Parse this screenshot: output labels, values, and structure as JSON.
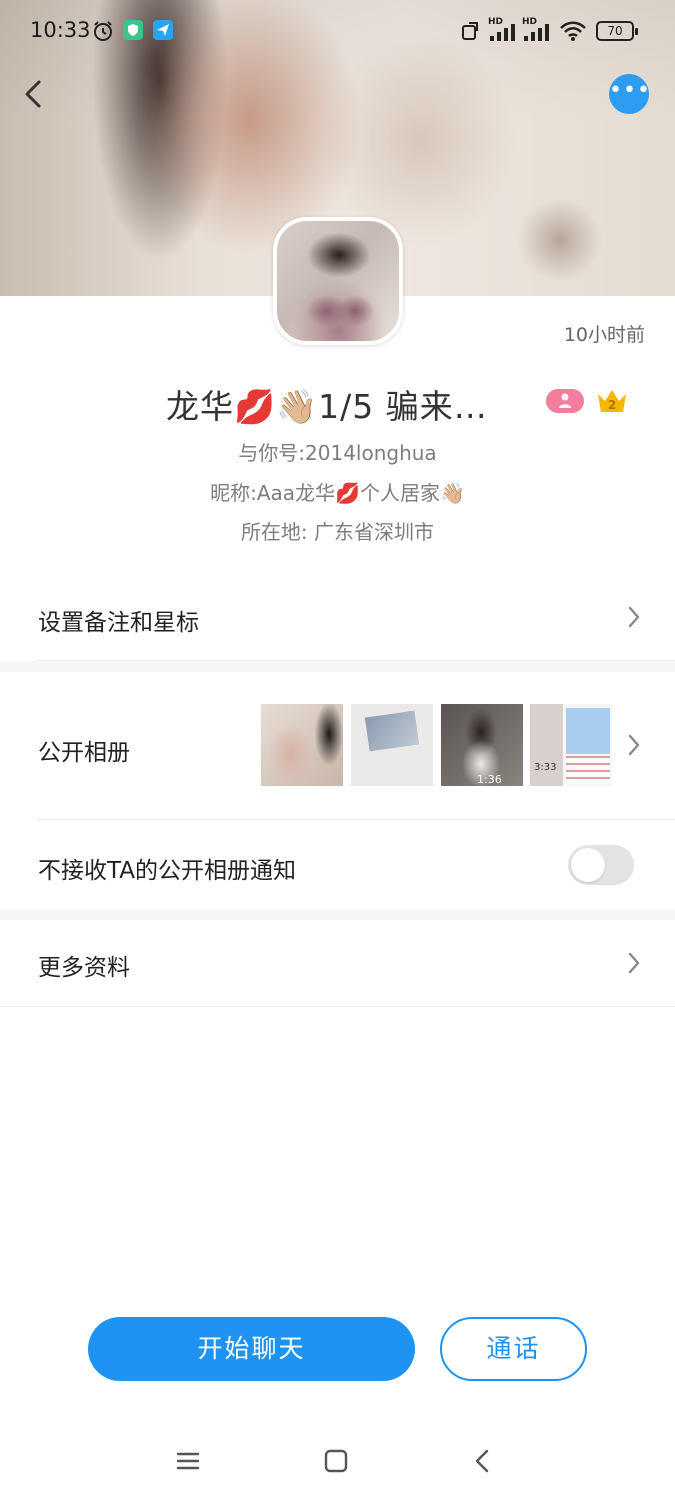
{
  "status_bar": {
    "time": "10:33",
    "network_1": "HD",
    "network_2": "HD",
    "battery": "70"
  },
  "cover": {
    "icon": "profile-cover-photo"
  },
  "header": {
    "back_icon": "chevron-left-icon",
    "more_icon": "more-dots-icon",
    "more_label": "•••"
  },
  "profile": {
    "time_ago": "10小时前",
    "name": "龙华💋👋🏼1/5  骗来…",
    "id_line": "与你号:2014longhua",
    "nickname_line": "昵称:Aaa龙华💋个人居家👋🏼",
    "location_line": "所在地: 广东省深圳市",
    "vip_badge_icon": "person-badge-icon",
    "crown_level": "2"
  },
  "menu": {
    "remark": "设置备注和星标",
    "album": "公开相册",
    "album_thumb_3_duration": "1:36",
    "album_thumb_4_time": "3:33",
    "mute_album": "不接收TA的公开相册通知",
    "mute_album_on": false,
    "more_info": "更多资料"
  },
  "actions": {
    "chat": "开始聊天",
    "call": "通话"
  },
  "colors": {
    "accent": "#1f93f1",
    "more_button": "#2f9cf4",
    "vip_badge": "#f47c9c",
    "crown": "#f5b800"
  }
}
